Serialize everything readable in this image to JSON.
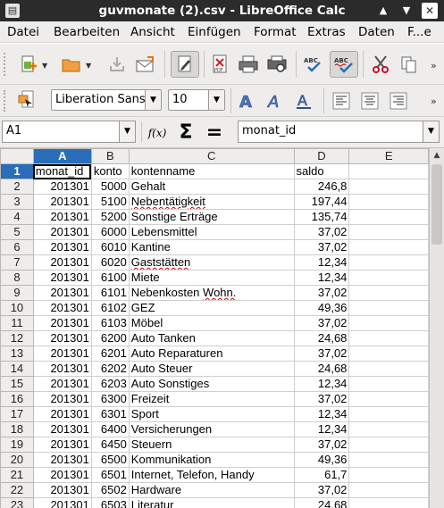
{
  "window": {
    "title": "guvmonate (2).csv - LibreOffice Calc",
    "controls": {
      "up": "▲",
      "down": "▼",
      "close": "✕"
    }
  },
  "menu": [
    "Datei",
    "Bearbeiten",
    "Ansicht",
    "Einfügen",
    "Format",
    "Extras",
    "Daten",
    "F...e"
  ],
  "format_toolbar": {
    "font_name": "Liberation Sans",
    "font_size": "10"
  },
  "formula_bar": {
    "name_box": "A1",
    "function_wizard_label": "f(x)",
    "sum_label": "Σ",
    "equals_label": "=",
    "content": "monat_id"
  },
  "sheet": {
    "columns": [
      "A",
      "B",
      "C",
      "D",
      "E"
    ],
    "header_row": [
      "monat_id",
      "konto",
      "kontenname",
      "saldo",
      ""
    ],
    "rows": [
      [
        "201301",
        "5000",
        "Gehalt",
        "246,8"
      ],
      [
        "201301",
        "5100",
        "Nebentätigkeit",
        "197,44"
      ],
      [
        "201301",
        "5200",
        "Sonstige Erträge",
        "135,74"
      ],
      [
        "201301",
        "6000",
        "Lebensmittel",
        "37,02"
      ],
      [
        "201301",
        "6010",
        "Kantine",
        "37,02"
      ],
      [
        "201301",
        "6020",
        "Gaststätten",
        "12,34"
      ],
      [
        "201301",
        "6100",
        "Miete",
        "12,34"
      ],
      [
        "201301",
        "6101",
        "Nebenkosten Wohn.",
        "37,02"
      ],
      [
        "201301",
        "6102",
        "GEZ",
        "49,36"
      ],
      [
        "201301",
        "6103",
        "Möbel",
        "37,02"
      ],
      [
        "201301",
        "6200",
        "Auto Tanken",
        "24,68"
      ],
      [
        "201301",
        "6201",
        "Auto Reparaturen",
        "37,02"
      ],
      [
        "201301",
        "6202",
        "Auto Steuer",
        "24,68"
      ],
      [
        "201301",
        "6203",
        "Auto Sonstiges",
        "12,34"
      ],
      [
        "201301",
        "6300",
        "Freizeit",
        "37,02"
      ],
      [
        "201301",
        "6301",
        "Sport",
        "12,34"
      ],
      [
        "201301",
        "6400",
        "Versicherungen",
        "12,34"
      ],
      [
        "201301",
        "6450",
        "Steuern",
        "37,02"
      ],
      [
        "201301",
        "6500",
        "Kommunikation",
        "49,36"
      ],
      [
        "201301",
        "6501",
        "Internet, Telefon, Handy",
        "61,7"
      ],
      [
        "201301",
        "6502",
        "Hardware",
        "37,02"
      ],
      [
        "201301",
        "6503",
        "Literatur",
        "24,68"
      ]
    ]
  },
  "colors": {
    "titlebar": "#2b2b2b",
    "toolbar_bg": "#eeedec",
    "selection_header": "#2a6db8",
    "gridline": "#cfcfcf"
  }
}
